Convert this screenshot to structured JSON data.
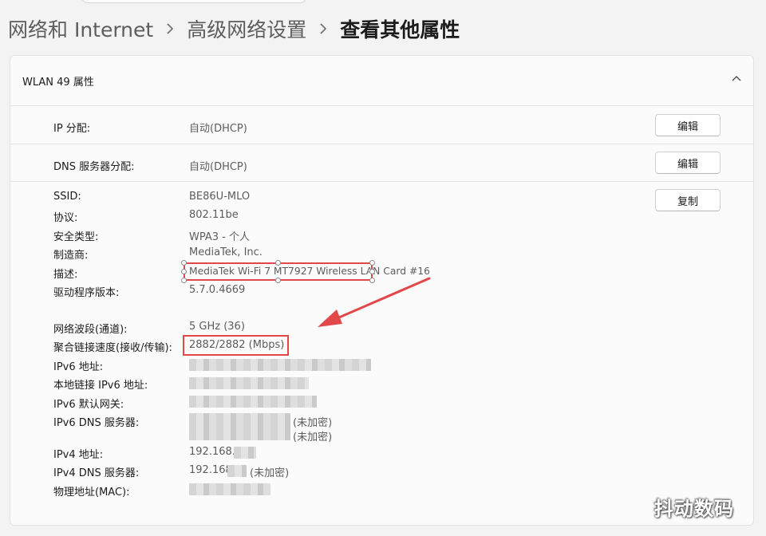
{
  "breadcrumb": {
    "items": [
      "网络和 Internet",
      "高级网络设置",
      "查看其他属性"
    ]
  },
  "panel": {
    "title": "WLAN 49 属性"
  },
  "rows": {
    "ip": {
      "label": "IP 分配:",
      "value": "自动(DHCP)",
      "button": "编辑"
    },
    "dns": {
      "label": "DNS 服务器分配:",
      "value": "自动(DHCP)",
      "button": "编辑"
    }
  },
  "details": {
    "copy_button": "复制",
    "ssid": {
      "label": "SSID:",
      "value": "BE86U-MLO"
    },
    "protocol": {
      "label": "协议:",
      "value": "802.11be"
    },
    "security": {
      "label": "安全类型:",
      "value": "WPA3 - 个人"
    },
    "manufacturer": {
      "label": "制造商:",
      "value": "MediaTek, Inc."
    },
    "description": {
      "label": "描述:",
      "value_main": "MediaTek Wi-Fi 7 MT7927 Wireless LAN",
      "value_rest": "Card #16"
    },
    "driver": {
      "label": "驱动程序版本:",
      "value": "5.7.0.4669"
    },
    "band": {
      "label": "网络波段(通道):",
      "value": "5 GHz (36)"
    },
    "speed": {
      "label": "聚合链接速度(接收/传输):",
      "value": "2882/2882 (Mbps)"
    },
    "ipv6": {
      "label": "IPv6 地址:"
    },
    "ipv6_local": {
      "label": "本地链接 IPv6 地址:"
    },
    "ipv6_gateway": {
      "label": "IPv6 默认网关:"
    },
    "ipv6_dns": {
      "label": "IPv6 DNS 服务器:",
      "suffix_1": "(未加密)",
      "suffix_2": "(未加密)"
    },
    "ipv4": {
      "label": "IPv4 地址:",
      "value": "192.168."
    },
    "ipv4_dns": {
      "label": "IPv4 DNS 服务器:",
      "value": "192.168",
      "suffix": "(未加密)"
    },
    "mac": {
      "label": "物理地址(MAC):"
    }
  },
  "annotation": {
    "highlight_color": "#e2474a"
  },
  "watermark": {
    "text": "抖动数码"
  },
  "colors": {
    "background": "#f3f3f3",
    "card": "#fbfbfb",
    "label_text": "#1b1b1b",
    "value_text": "#5c5c5c"
  }
}
